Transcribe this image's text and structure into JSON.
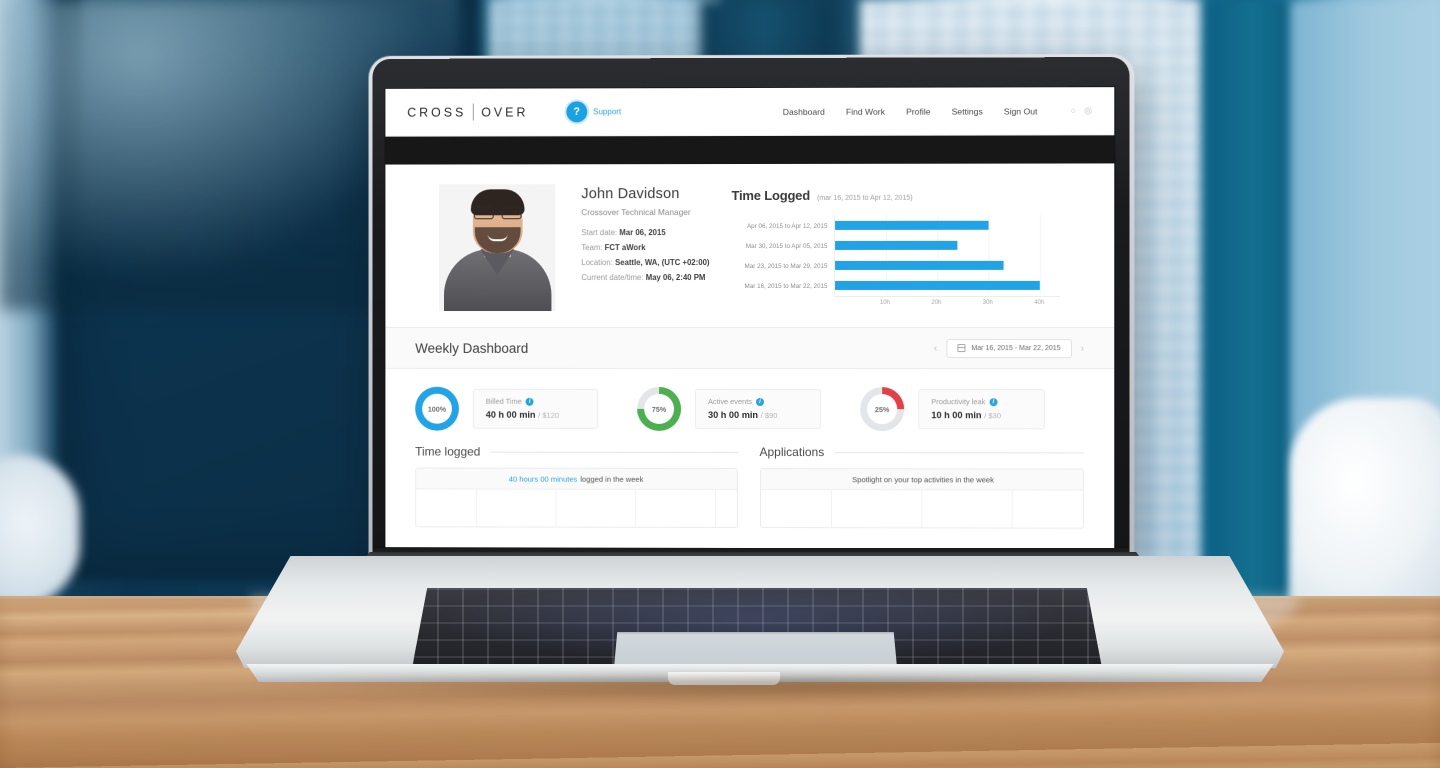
{
  "header": {
    "logo_left": "CROSS",
    "logo_right": "OVER",
    "support_badge": "?",
    "support_label": "Support",
    "nav": [
      {
        "label": "Dashboard"
      },
      {
        "label": "Find Work"
      },
      {
        "label": "Profile"
      },
      {
        "label": "Settings"
      },
      {
        "label": "Sign Out"
      }
    ],
    "icons": [
      {
        "name": "notification-bell-icon",
        "glyph": "○"
      },
      {
        "name": "gear-icon",
        "glyph": "◎"
      }
    ]
  },
  "profile": {
    "name": "John Davidson",
    "title": "Crossover Technical Manager",
    "fields": [
      {
        "label": "Start date:",
        "value": "Mar 06, 2015"
      },
      {
        "label": "Team:",
        "value": "FCT aWork"
      },
      {
        "label": "Location:",
        "value": "Seattle, WA, (UTC +02:00)"
      },
      {
        "label": "Current date/time:",
        "value": "May 06, 2:40 PM"
      }
    ]
  },
  "time_logged": {
    "title": "Time Logged",
    "subtitle": "(mar 16, 2015 to Apr 12, 2015)"
  },
  "chart_data": {
    "type": "bar",
    "orientation": "horizontal",
    "title": "Time Logged",
    "subtitle": "(mar 16, 2015 to Apr 12, 2015)",
    "xlabel": "",
    "ylabel": "",
    "xlim": [
      0,
      44
    ],
    "xticks": [
      10,
      20,
      30,
      40
    ],
    "xtick_labels": [
      "10h",
      "20h",
      "30h",
      "40h"
    ],
    "grid": true,
    "legend": false,
    "series_color": "#22a3e6",
    "categories": [
      "Apr 06, 2015 to Apr 12, 2015",
      "Mar 30, 2015 to Apr 05, 2015",
      "Mar 23, 2015 to Mar 29, 2015",
      "Mar 16, 2015 to Mar 22, 2015"
    ],
    "values": [
      30,
      24,
      33,
      40
    ],
    "units": "hours"
  },
  "weekly": {
    "title": "Weekly Dashboard",
    "prev_label": "‹",
    "next_label": "›",
    "date_range": "Mar 16, 2015 - Mar 22, 2015",
    "calendar_icon": "calendar-icon"
  },
  "kpis": [
    {
      "percent": "100%",
      "percent_value": 100,
      "gauge_color": "#22a3e6",
      "label": "Billed Time",
      "value": "40 h 00 min",
      "amount": "/ $120"
    },
    {
      "percent": "75%",
      "percent_value": 75,
      "gauge_color": "#4caf50",
      "label": "Active events",
      "value": "30 h 00 min",
      "amount": "/ $90"
    },
    {
      "percent": "25%",
      "percent_value": 25,
      "gauge_color": "#e0404a",
      "label": "Productivity leak",
      "value": "10 h 00 min",
      "amount": "/ $30"
    }
  ],
  "panels": [
    {
      "heading": "Time logged",
      "strip_highlight": "40 hours 00 minutes",
      "strip_rest": "logged in the week"
    },
    {
      "heading": "Applications",
      "strip_highlight": "",
      "strip_rest": "Spotlight on your top activities in the week"
    }
  ],
  "colors": {
    "accent_blue": "#22a3e6",
    "green": "#4caf50",
    "red": "#e0404a",
    "dark_bar": "#171717"
  }
}
